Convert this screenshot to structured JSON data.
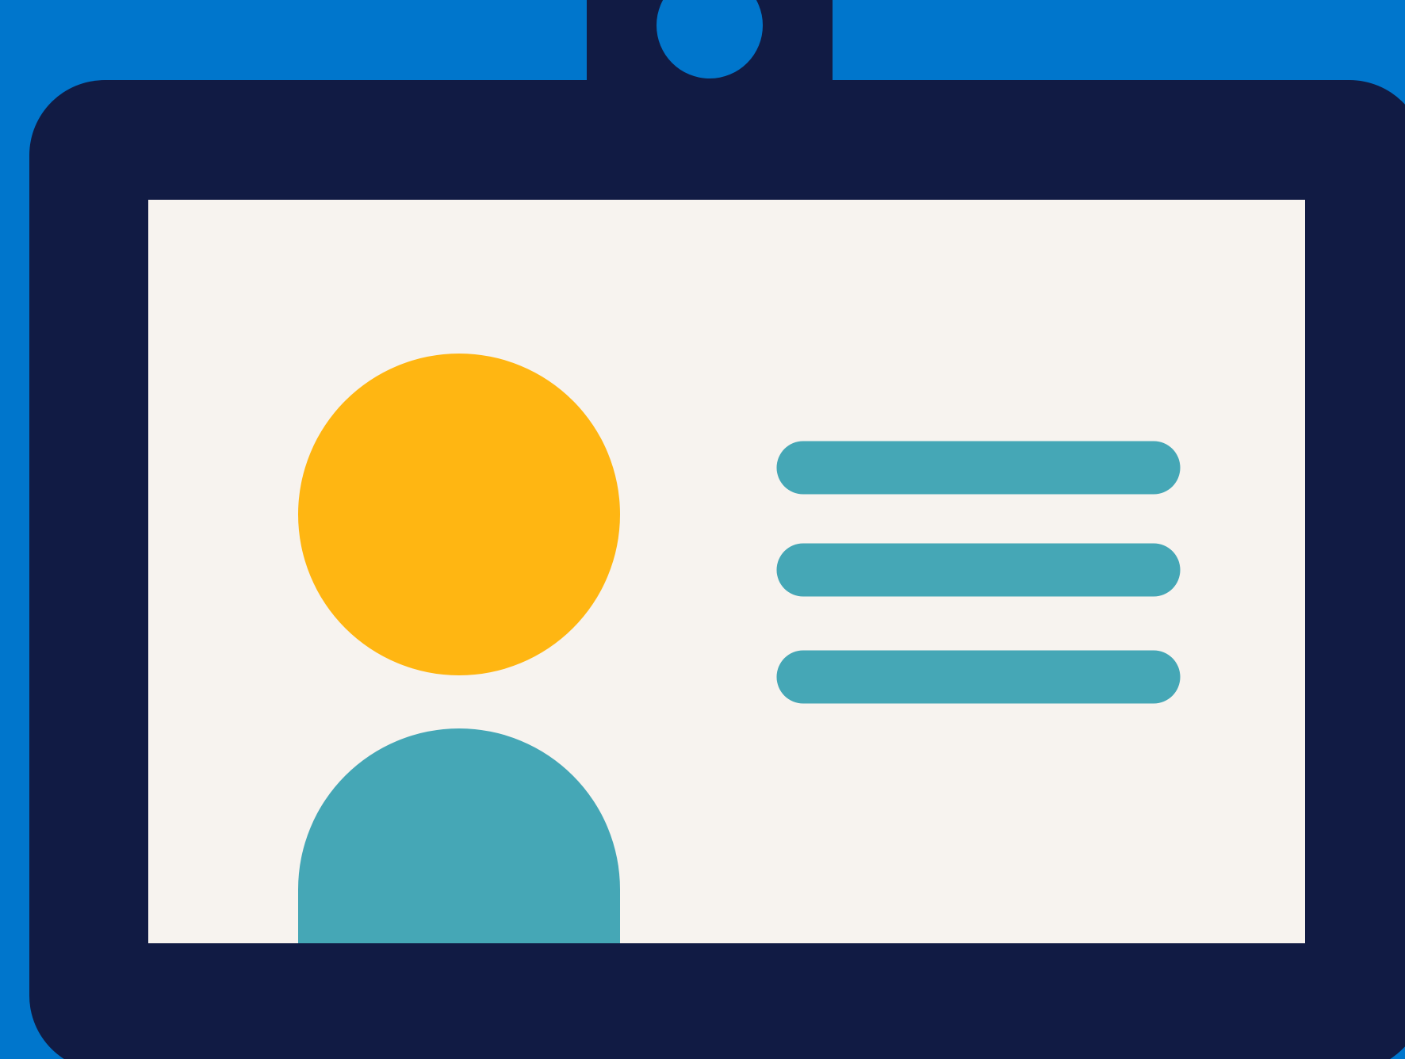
{
  "illustration": {
    "subject": "id-badge-icon",
    "colors": {
      "background": "#0076CC",
      "badge_frame": "#111B44",
      "card_face": "#F7F3EF",
      "avatar_head": "#FFB612",
      "avatar_body": "#45A7B6",
      "text_lines": "#45A7B6",
      "clip_hole": "#0076CC"
    },
    "text_line_count": 3
  }
}
